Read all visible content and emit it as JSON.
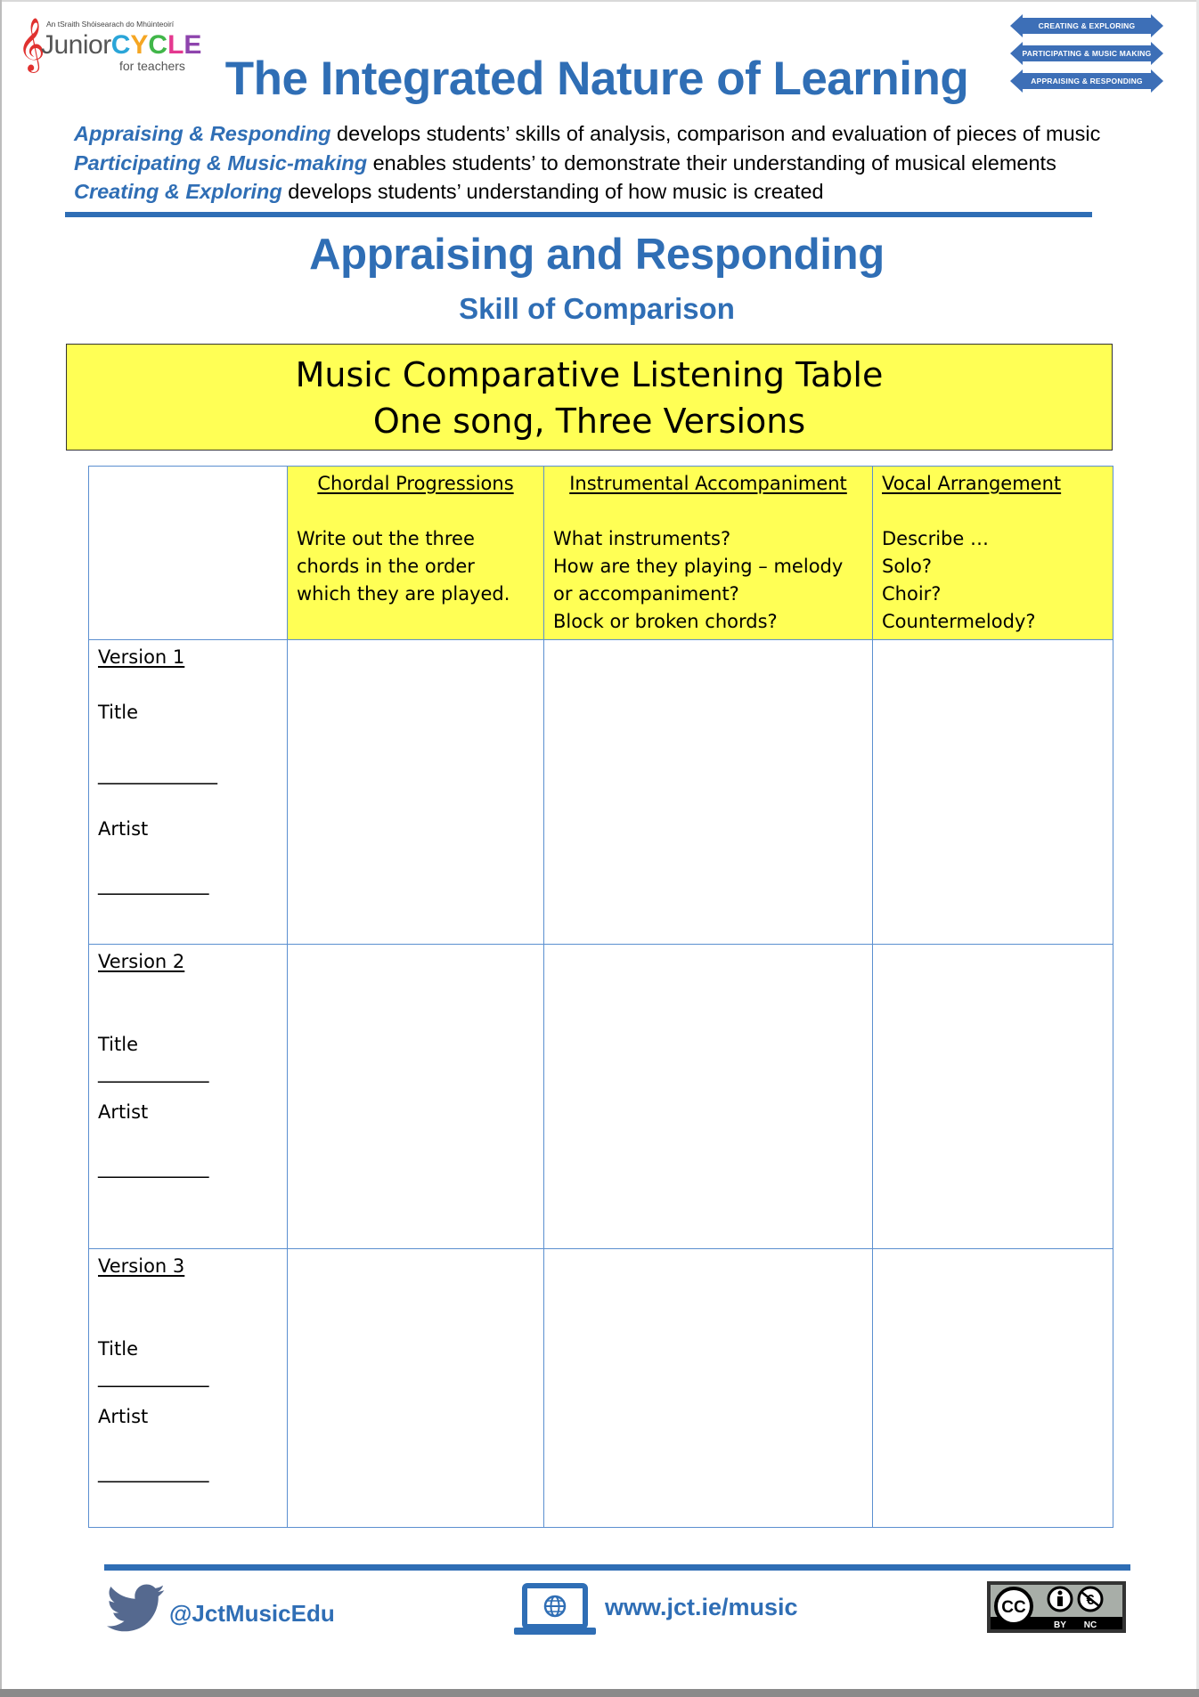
{
  "logo": {
    "tagline": "An tSraith Shóisearach do Mhúinteoirí",
    "brand_junior": "Junior",
    "brand_cycle": [
      "C",
      "Y",
      "C",
      "L",
      "E"
    ],
    "subtitle": "for teachers",
    "icon": "treble-clef-icon"
  },
  "strands_graphic": {
    "arrows": [
      "Creating & Exploring",
      "Participating & Music Making",
      "Appraising & Responding"
    ],
    "color": "#3d6fb7"
  },
  "header": {
    "title": "The Integrated Nature of Learning",
    "intro_lines": [
      {
        "lead": "Appraising & Responding",
        "text": " develops students’ skills of analysis, comparison and evaluation of pieces of music"
      },
      {
        "lead": "Participating & Music-making",
        "text": " enables students’ to demonstrate their understanding of musical elements"
      },
      {
        "lead": "Creating & Exploring",
        "text": " develops students’ understanding of how music is created"
      }
    ]
  },
  "section": {
    "title": "Appraising and Responding",
    "subtitle": "Skill of Comparison"
  },
  "banner": {
    "line1": "Music Comparative Listening Table",
    "line2": "One song, Three Versions",
    "background": "#ffff55"
  },
  "table": {
    "columns": [
      {
        "title": "",
        "description": ""
      },
      {
        "title": "Chordal Progressions",
        "description": "Write out the three\nchords in the order\nwhich they are played."
      },
      {
        "title": "Instrumental Accompaniment",
        "description": "What instruments?\nHow are they playing – melody\nor accompaniment?\nBlock or broken chords?"
      },
      {
        "title": "Vocal Arrangement",
        "description": "Describe …\nSolo?\nChoir?\nCountermelody?"
      }
    ],
    "rows": [
      {
        "version": "Version  1",
        "title_label": "Title",
        "title_blank": "______________",
        "artist_label": "Artist",
        "artist_blank": "_____________",
        "cells": [
          "",
          "",
          ""
        ]
      },
      {
        "version": "Version  2",
        "title_label": "Title",
        "title_blank": "_____________",
        "artist_label": "Artist",
        "artist_blank": "_____________",
        "cells": [
          "",
          "",
          ""
        ]
      },
      {
        "version": "Version  3",
        "title_label": "Title",
        "title_blank": "_____________",
        "artist_label": "Artist",
        "artist_blank": "_____________",
        "cells": [
          "",
          "",
          ""
        ]
      }
    ],
    "border_color": "#5b8fd0"
  },
  "footer": {
    "twitter_handle": "@JctMusicEdu",
    "website": "www.jct.ie/music",
    "license": {
      "badge": "CC",
      "labels": [
        "BY",
        "NC"
      ]
    }
  },
  "colors": {
    "brand_blue": "#2f6eb5",
    "yellow": "#ffff55"
  }
}
